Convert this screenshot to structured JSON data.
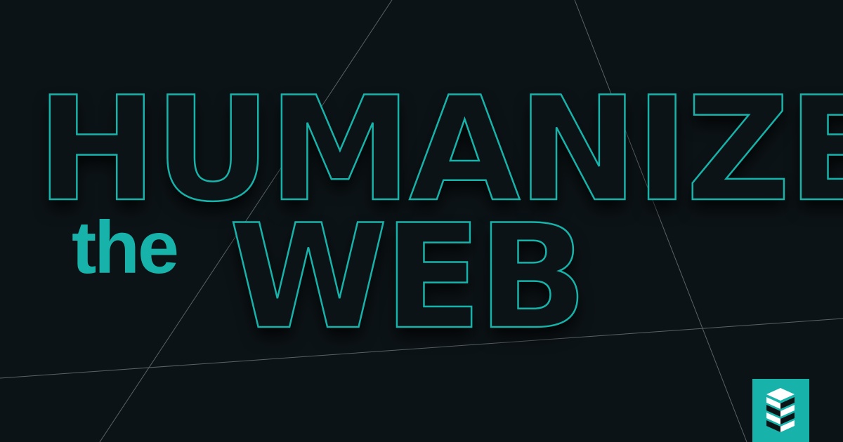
{
  "headline": {
    "line1": "HUMANIZE",
    "connector": "the",
    "line2": "WEB"
  },
  "logo": {
    "icon": "stacked-layers-icon"
  },
  "colors": {
    "background": "#0c1316",
    "accent": "#17b3aa",
    "line": "#5b6266"
  }
}
